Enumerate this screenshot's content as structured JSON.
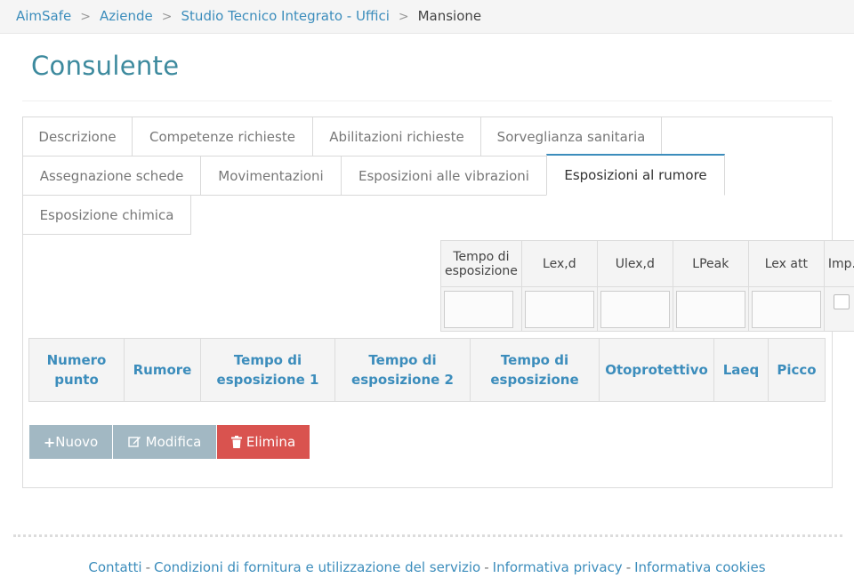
{
  "breadcrumb": {
    "items": [
      "AimSafe",
      "Aziende",
      "Studio Tecnico Integrato - Uffici"
    ],
    "current": "Mansione"
  },
  "page": {
    "title": "Consulente"
  },
  "tabs": [
    "Descrizione",
    "Competenze richieste",
    "Abilitazioni richieste",
    "Sorveglianza sanitaria",
    "Assegnazione schede",
    "Movimentazioni",
    "Esposizioni alle vibrazioni",
    "Esposizioni al rumore",
    "Esposizione chimica"
  ],
  "active_tab": "Esposizioni al rumore",
  "summary_table": {
    "headers": [
      "Tempo di esposizione",
      "Lex,d",
      "Ulex,d",
      "LPeak",
      "Lex att",
      "Imp."
    ]
  },
  "main_table": {
    "headers": [
      "Numero punto",
      "Rumore",
      "Tempo di esposizione 1",
      "Tempo di esposizione 2",
      "Tempo di esposizione",
      "Otoprotettivo",
      "Laeq",
      "Picco"
    ]
  },
  "buttons": {
    "nuovo": "Nuovo",
    "modifica": "Modifica",
    "elimina": "Elimina"
  },
  "footer": {
    "links": [
      "Contatti",
      "Condizioni di fornitura e utilizzazione del servizio",
      "Informativa privacy",
      "Informativa cookies"
    ],
    "separator": "-"
  },
  "colors": {
    "link": "#3c8dbc",
    "title": "#3d8a9e",
    "danger": "#d9534f",
    "muted_button": "#a2b8c3"
  }
}
